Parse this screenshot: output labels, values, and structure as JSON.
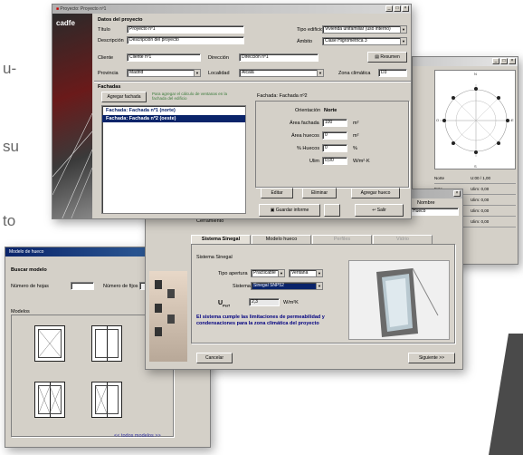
{
  "background_text": {
    "line1": "u-",
    "line2": "su",
    "line3": "to"
  },
  "main_window": {
    "title": "Proyecto: Proyecto nº1",
    "logo": "cadfe",
    "section_project": "Datos del proyecto",
    "fields": {
      "titulo_label": "Título",
      "titulo_value": "Proyecto nº1",
      "descripcion_label": "Descripción",
      "descripcion_value": "Descripción del proyecto",
      "tipo_edificio_label": "Tipo edificio",
      "tipo_edificio_value": "Vivienda unifamiliar (uso interno)",
      "ambito_label": "Ámbito",
      "ambito_value": "Clase Higrométrica 3",
      "cliente_label": "Cliente",
      "cliente_value": "Cliente nº1",
      "direccion_label": "Dirección",
      "direccion_value": "Dirección nº1",
      "provincia_label": "Provincia",
      "provincia_value": "Madrid",
      "localidad_label": "Localidad",
      "localidad_value": "Alcalá",
      "zona_label": "Zona climática",
      "zona_value": "D3"
    },
    "resumen_button": "Resumen",
    "section_facades": "Fachadas",
    "add_facade_button": "Agregar fachada",
    "add_facade_hint": "Para agregar el cálculo de ventanas en la fachada del edificio",
    "facade_items": [
      "Fachada: Fachada nº1 (norte)",
      "Fachada: Fachada nº2 (oeste)"
    ],
    "facade_props_title": "Fachada: Fachada nº2",
    "facade_props": [
      {
        "label": "Orientación",
        "value": "Norte",
        "unit": ""
      },
      {
        "label": "Área fachada",
        "value": "100",
        "unit": "m²"
      },
      {
        "label": "Área huecos",
        "value": "0",
        "unit": "m²"
      },
      {
        "label": "% Huecos",
        "value": "0",
        "unit": "%"
      },
      {
        "label": "Ulim",
        "value": "0,00",
        "unit": "W/m²·K"
      }
    ],
    "buttons": {
      "editar": "Editar",
      "eliminar": "Eliminar",
      "agregar_hueco": "Agregar hueco",
      "guardar_informe": "Guardar informe",
      "salir": "Salir"
    }
  },
  "right_window": {
    "table_rows": [
      {
        "a": "Norte",
        "b": "U:00 / 1,00"
      },
      {
        "a": "Este",
        "b": "Ulim: 0,00"
      },
      {
        "a": "Sur",
        "b": "Ulim: 0,00"
      },
      {
        "a": "Oeste",
        "b": "Ulim: 0,00"
      },
      {
        "a": "Noreste",
        "b": "Ulim: 0,00"
      }
    ],
    "rose_labels": [
      "N",
      "E",
      "S",
      "O"
    ]
  },
  "hueco_window": {
    "title": "Hueco",
    "nombre_label": "Nombre",
    "nombre_value": "Hueco",
    "section_label": "Cerramiento",
    "tabs": [
      "Sistema Sinegal",
      "Modelo hueco",
      "Perfiles",
      "Vidrio"
    ],
    "group_label": "Sistema Sinegal",
    "tipo_label": "Tipo apertura",
    "tipo_value": "Practicable",
    "tipo_value2": "Ventana",
    "sistema_label": "Sistema",
    "sistema_value": "Sinegal SNP52",
    "u_label": "U",
    "u_sub": "Perf",
    "u_value": "2,3",
    "u_unit": "W/m²K",
    "notice": "El sistema cumple las limitaciones de permeabilidad y condensaciones para la zona climática del proyecto",
    "cancel_button": "Cancelar",
    "next_button": "Siguiente >>"
  },
  "modelo_window": {
    "title": "Modelo de hueco",
    "section": "Buscar modelo",
    "num_hojas_label": "Número de hojas",
    "num_fijos_label": "Número de fijos",
    "modelos_label": "Modelos",
    "pager": "<<   todos modelos   >>"
  },
  "colors": {
    "dialog": "#d4d0c8",
    "titlebar": "#0a246a",
    "selection": "#0a246a",
    "notice_text": "#000080",
    "accent_bar": "#444444"
  },
  "icons": [
    "window-logo-icon",
    "document-icon",
    "save-icon",
    "exit-icon",
    "close-icon",
    "minimize-icon",
    "maximize-icon",
    "dropdown-arrow-icon",
    "window-profile-image"
  ]
}
